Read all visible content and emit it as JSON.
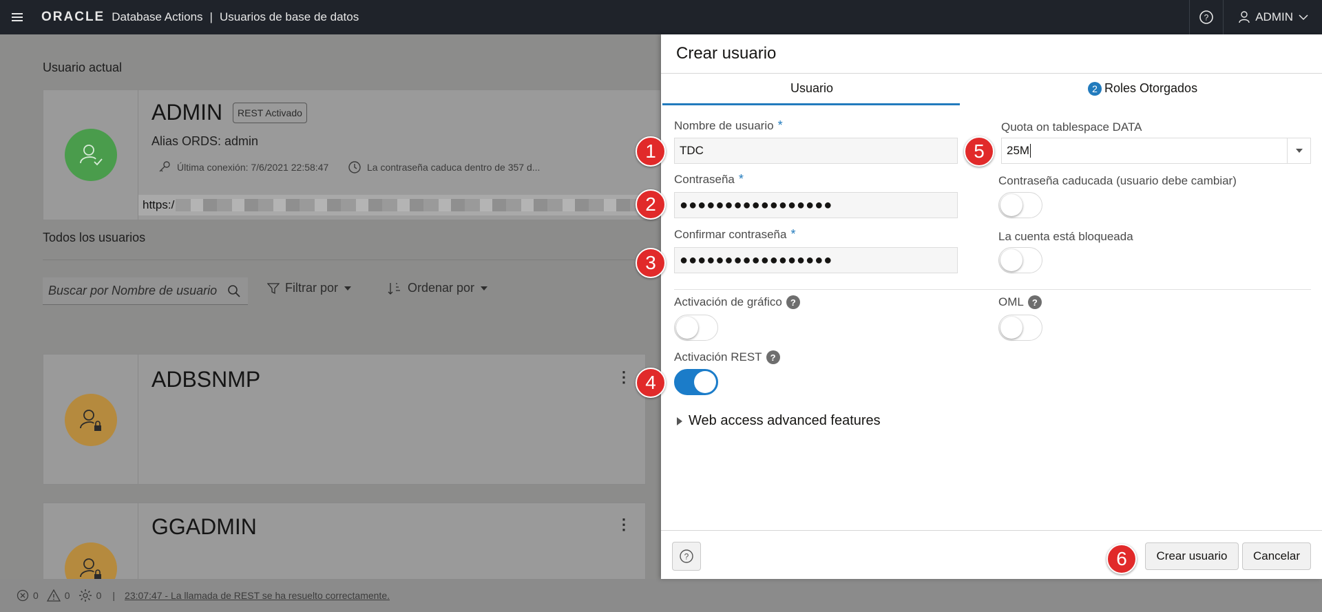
{
  "topbar": {
    "brand": "ORACLE",
    "app_name": "Database Actions",
    "separator": "|",
    "page_name": "Usuarios de base de datos",
    "user": "ADMIN"
  },
  "background": {
    "current_user_label": "Usuario actual",
    "current_user": {
      "name": "ADMIN",
      "badge": "REST Activado",
      "alias": "Alias ORDS: admin",
      "last_login": "Última conexión: 7/6/2021 22:58:47",
      "password_expiry": "La contraseña caduca dentro de 357 d...",
      "url_prefix": "https:/"
    },
    "all_users_label": "Todos los usuarios",
    "search_placeholder": "Buscar por Nombre de usuario",
    "filter_label": "Filtrar por",
    "sort_label": "Ordenar por",
    "users": [
      {
        "name": "ADBSNMP"
      },
      {
        "name": "GGADMIN"
      }
    ]
  },
  "drawer": {
    "title": "Crear usuario",
    "tabs": [
      {
        "label": "Usuario"
      },
      {
        "number": "2",
        "label": "Roles Otorgados"
      }
    ],
    "fields": {
      "username_label": "Nombre de usuario",
      "username_value": "TDC",
      "required_mark": "*",
      "password_label": "Contraseña",
      "password_value": "●●●●●●●●●●●●●●●●●",
      "confirm_label": "Confirmar contraseña",
      "confirm_value": "●●●●●●●●●●●●●●●●●",
      "quota_label": "Quota on tablespace DATA",
      "quota_value": "25M",
      "pw_expired_label": "Contraseña caducada (usuario debe cambiar)",
      "locked_label": "La cuenta está bloqueada",
      "graph_label": "Activación de gráfico",
      "oml_label": "OML",
      "rest_label": "Activación REST",
      "help_glyph": "?"
    },
    "toggles": {
      "pw_expired": false,
      "locked": false,
      "graph": false,
      "oml": false,
      "rest": true
    },
    "advanced_label": "Web access advanced features",
    "create_button": "Crear usuario",
    "cancel_button": "Cancelar"
  },
  "markers": [
    "1",
    "2",
    "3",
    "4",
    "5",
    "6"
  ],
  "statusbar": {
    "errors": "0",
    "warnings": "0",
    "tasks": "0",
    "separator": "|",
    "message": "23:07:47 - La llamada de REST se ha resuelto correctamente."
  },
  "colors": {
    "accent": "#227bbd",
    "marker": "#e12a2a",
    "avatar_admin": "#4a9c4c",
    "avatar_user": "#b58a3e"
  }
}
